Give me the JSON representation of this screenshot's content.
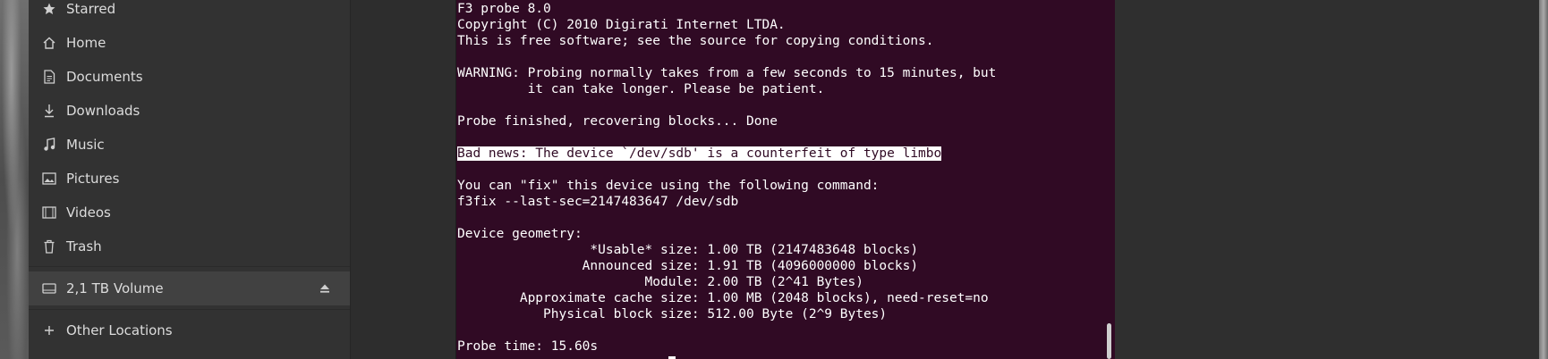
{
  "sidebar": {
    "items": [
      {
        "label": "Starred",
        "icon": "star-icon"
      },
      {
        "label": "Home",
        "icon": "home-icon"
      },
      {
        "label": "Documents",
        "icon": "document-icon"
      },
      {
        "label": "Downloads",
        "icon": "download-icon"
      },
      {
        "label": "Music",
        "icon": "music-icon"
      },
      {
        "label": "Pictures",
        "icon": "picture-icon"
      },
      {
        "label": "Videos",
        "icon": "video-icon"
      },
      {
        "label": "Trash",
        "icon": "trash-icon"
      }
    ],
    "volume": {
      "label": "2,1 TB Volume",
      "icon": "drive-icon",
      "eject_icon": "eject-icon"
    },
    "other_locations": {
      "label": "Other Locations",
      "icon": "plus-icon"
    }
  },
  "terminal": {
    "lines": [
      "F3 probe 8.0",
      "Copyright (C) 2010 Digirati Internet LTDA.",
      "This is free software; see the source for copying conditions.",
      "",
      "WARNING: Probing normally takes from a few seconds to 15 minutes, but",
      "         it can take longer. Please be patient.",
      "",
      "Probe finished, recovering blocks... Done",
      "",
      "Bad news: The device `/dev/sdb' is a counterfeit of type limbo",
      "",
      "You can \"fix\" this device using the following command:",
      "f3fix --last-sec=2147483647 /dev/sdb",
      "",
      "Device geometry:",
      "                 *Usable* size: 1.00 TB (2147483648 blocks)",
      "                Announced size: 1.91 TB (4096000000 blocks)",
      "                        Module: 2.00 TB (2^41 Bytes)",
      "        Approximate cache size: 1.00 MB (2048 blocks), need-reset=no",
      "           Physical block size: 512.00 Byte (2^9 Bytes)",
      "",
      "Probe time: 15.60s"
    ],
    "highlighted_line_index": 9
  },
  "colors": {
    "terminal_bg": "#300a24",
    "sidebar_bg": "#323232",
    "selected_bg": "#414141"
  }
}
